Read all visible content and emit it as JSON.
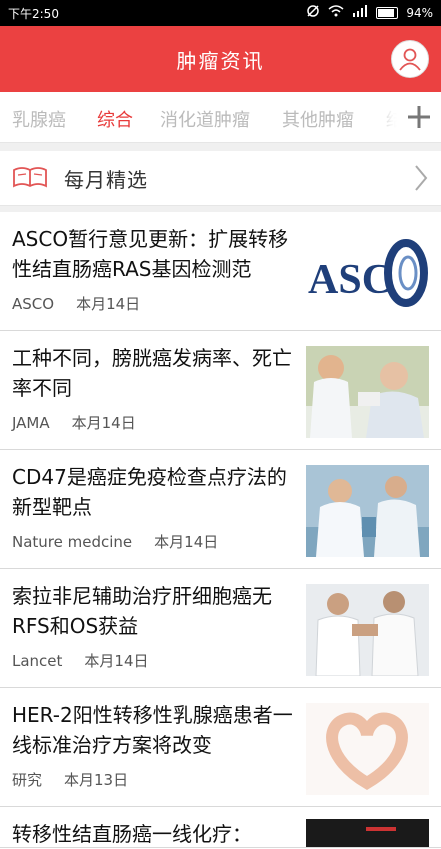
{
  "status": {
    "time": "下午2:50",
    "battery": "94%"
  },
  "header": {
    "title": "肿瘤资讯",
    "avatar_icon": "user-icon"
  },
  "tabs": [
    {
      "label": "乳腺癌",
      "active": false
    },
    {
      "label": "综合",
      "active": true
    },
    {
      "label": "消化道肿瘤",
      "active": false
    },
    {
      "label": "其他肿瘤",
      "active": false
    },
    {
      "label": "结",
      "active": false
    }
  ],
  "monthly": {
    "label": "每月精选",
    "icon": "book-icon"
  },
  "news": [
    {
      "title": "ASCO暂行意见更新：扩展转移性结直肠癌RAS基因检测范",
      "source": "ASCO",
      "date": "本月14日",
      "thumb": "asco-logo"
    },
    {
      "title": "工种不同，膀胱癌发病率、死亡率不同",
      "source": "JAMA",
      "date": "本月14日",
      "thumb": "doctor-patient-photo"
    },
    {
      "title": "CD47是癌症免疫检查点疗法的新型靶点",
      "source": "Nature medcine",
      "date": "本月14日",
      "thumb": "lab-scientists-photo"
    },
    {
      "title": "索拉非尼辅助治疗肝细胞癌无RFS和OS获益",
      "source": "Lancet",
      "date": "本月14日",
      "thumb": "doctors-discussion-photo"
    },
    {
      "title": "HER-2阳性转移性乳腺癌患者一线标准治疗方案将改变",
      "source": "研究",
      "date": "本月13日",
      "thumb": "heart-hands-photo"
    },
    {
      "title": "转移性结直肠癌一线化疗：",
      "source": "",
      "date": "",
      "thumb": "dark-image"
    }
  ],
  "colors": {
    "brand_red": "#eb4141",
    "tab_active": "#e83b3b",
    "tab_inactive": "#bbbbbb"
  }
}
